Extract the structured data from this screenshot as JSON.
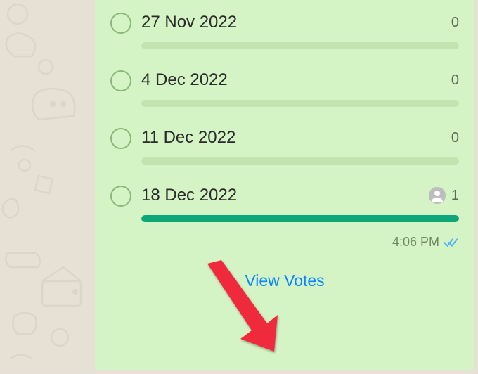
{
  "poll": {
    "options": [
      {
        "label": "27 Nov 2022",
        "votes": 0,
        "progress": 0,
        "has_voter": false
      },
      {
        "label": "4 Dec 2022",
        "votes": 0,
        "progress": 0,
        "has_voter": false
      },
      {
        "label": "11 Dec 2022",
        "votes": 0,
        "progress": 0,
        "has_voter": false
      },
      {
        "label": "18 Dec 2022",
        "votes": 1,
        "progress": 100,
        "has_voter": true
      }
    ],
    "timestamp": "4:06 PM",
    "view_votes_label": "View Votes"
  },
  "colors": {
    "card_bg": "#d5f4c5",
    "progress_fill": "#0ca67a",
    "link": "#0a87ff",
    "tick": "#4fb6f6"
  }
}
